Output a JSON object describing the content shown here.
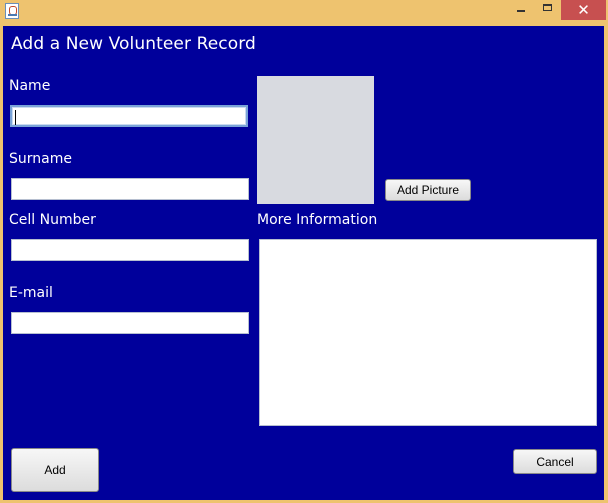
{
  "window": {
    "title": "",
    "controls": {
      "minimize": "",
      "maximize": "",
      "close": "✕"
    }
  },
  "form": {
    "heading": "Add a New Volunteer Record",
    "name_label": "Name",
    "name_value": "",
    "surname_label": "Surname",
    "surname_value": "",
    "cell_label": "Cell Number",
    "cell_value": "",
    "email_label": "E-mail",
    "email_value": "",
    "more_info_label": "More Information",
    "more_info_value": ""
  },
  "buttons": {
    "add_picture": "Add Picture",
    "add": "Add",
    "cancel": "Cancel"
  },
  "colors": {
    "panel_background": "#00009b",
    "titlebar_background": "#eec36f",
    "close_button": "#c75050",
    "text": "#ffffff",
    "picture_placeholder": "#d8dae0"
  },
  "icons": {
    "app_icon": "java-cup-icon"
  }
}
